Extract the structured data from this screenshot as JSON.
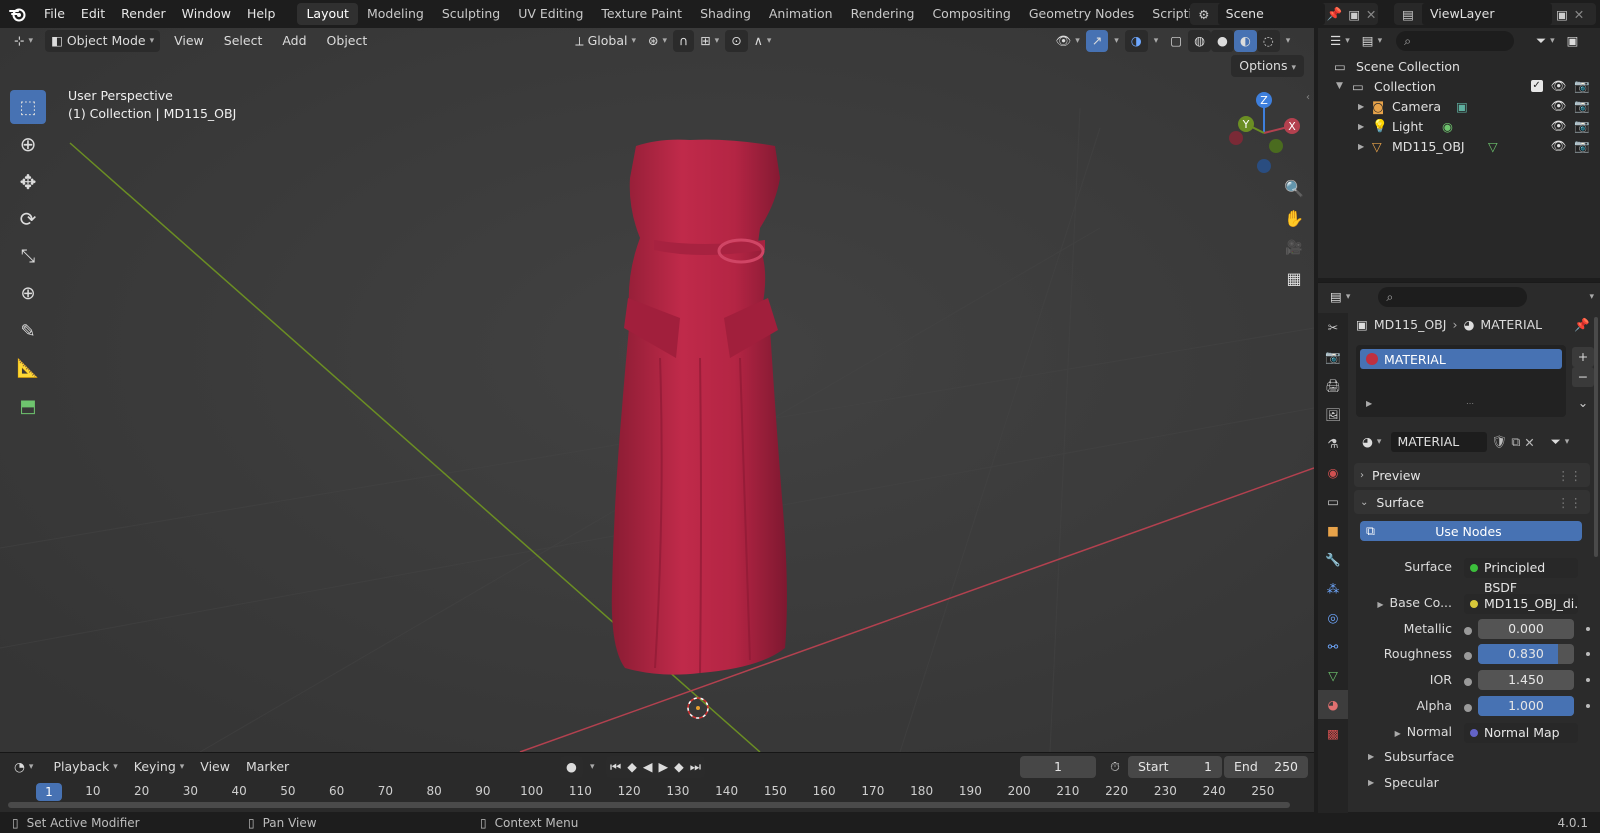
{
  "topbar": {
    "menus": [
      "File",
      "Edit",
      "Render",
      "Window",
      "Help"
    ],
    "workspaces": [
      "Layout",
      "Modeling",
      "Sculpting",
      "UV Editing",
      "Texture Paint",
      "Shading",
      "Animation",
      "Rendering",
      "Compositing",
      "Geometry Nodes",
      "Scripting"
    ],
    "active_workspace": "Layout",
    "scene_name": "Scene",
    "view_layer": "ViewLayer"
  },
  "viewport": {
    "mode": "Object Mode",
    "menus": [
      "View",
      "Select",
      "Add",
      "Object"
    ],
    "orientation": "Global",
    "options_label": "Options",
    "overlay_line1": "User Perspective",
    "overlay_line2": "(1) Collection | MD115_OBJ",
    "gizmo_axes": [
      "Z",
      "Y",
      "X"
    ],
    "colors": {
      "x_axis": "#b3414f",
      "y_axis": "#6b8e23",
      "z_axis": "#3e7fdc",
      "object": "#b42544"
    }
  },
  "timeline": {
    "menus": [
      "Playback",
      "Keying",
      "View",
      "Marker"
    ],
    "current_frame": "1",
    "start_label": "Start",
    "start_value": "1",
    "end_label": "End",
    "end_value": "250",
    "ruler_ticks": [
      "10",
      "20",
      "30",
      "40",
      "50",
      "60",
      "70",
      "80",
      "90",
      "100",
      "110",
      "120",
      "130",
      "140",
      "150",
      "160",
      "170",
      "180",
      "190",
      "200",
      "210",
      "220",
      "230",
      "240",
      "250"
    ]
  },
  "statusbar": {
    "left": "Set Active Modifier",
    "middle": "Pan View",
    "right": "Context Menu",
    "version": "4.0.1"
  },
  "outliner": {
    "scene_collection": "Scene Collection",
    "collection": "Collection",
    "items": [
      "Camera",
      "Light",
      "MD115_OBJ"
    ]
  },
  "properties": {
    "breadcrumb_object": "MD115_OBJ",
    "breadcrumb_material": "MATERIAL",
    "slot_name": "MATERIAL",
    "material_name": "MATERIAL",
    "preview_label": "Preview",
    "surface_section": "Surface",
    "use_nodes": "Use Nodes",
    "surface_label": "Surface",
    "surface_value": "Principled BSDF",
    "base_color_label": "Base Co...",
    "base_color_value": "MD115_OBJ_di...",
    "metallic_label": "Metallic",
    "metallic_value": "0.000",
    "roughness_label": "Roughness",
    "roughness_value": "0.830",
    "ior_label": "IOR",
    "ior_value": "1.450",
    "alpha_label": "Alpha",
    "alpha_value": "1.000",
    "normal_label": "Normal",
    "normal_value": "Normal Map",
    "subsurface_label": "Subsurface",
    "specular_label": "Specular",
    "roughness_fill": 0.83,
    "alpha_fill": 1.0
  }
}
